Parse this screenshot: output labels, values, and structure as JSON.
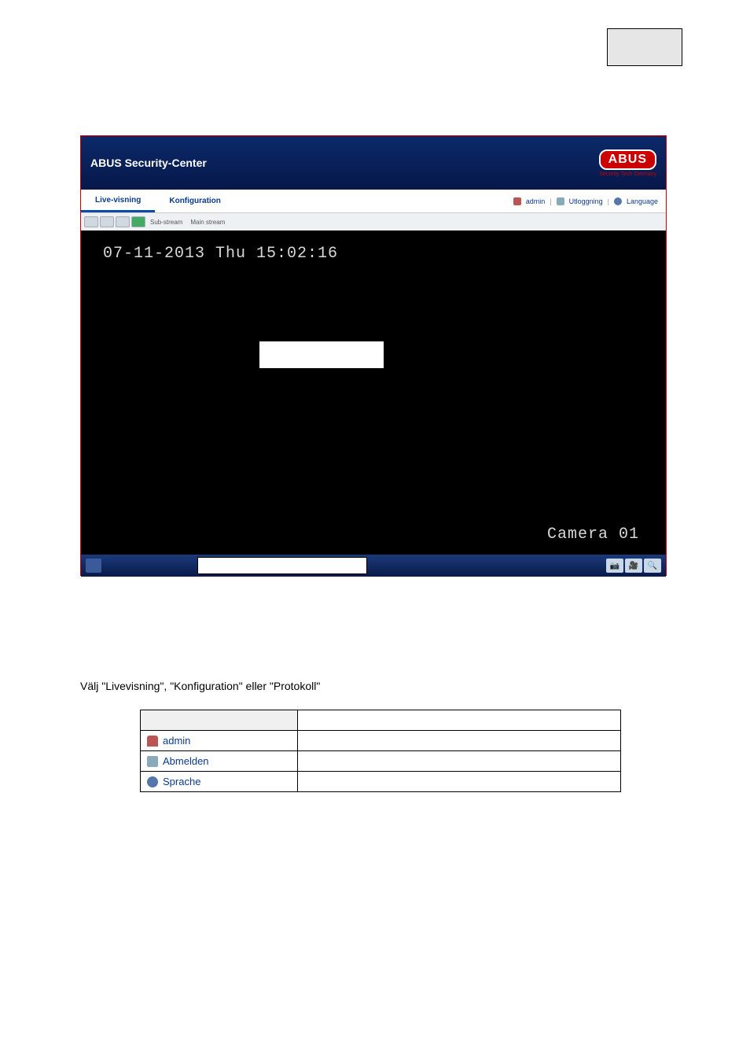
{
  "header": {
    "title_bold": "ABUS",
    "title_rest": "Security-Center",
    "logo_text": "ABUS",
    "logo_sub": "Security Tech Germany"
  },
  "tabs": {
    "live": "Live-visning",
    "config": "Konfiguration"
  },
  "topright": {
    "user": "admin",
    "logout": "Utloggning",
    "language": "Language"
  },
  "toolbar": {
    "sub": "Sub-stream",
    "main": "Main stream"
  },
  "video": {
    "timestamp": "07-11-2013 Thu 15:02:16",
    "camera": "Camera 01"
  },
  "caption": "Välj \"Livevisning\", \"Konfiguration\" eller \"Protokoll\"",
  "table": {
    "rows": [
      {
        "label": "admin",
        "icon": "user"
      },
      {
        "label": "Abmelden",
        "icon": "logout"
      },
      {
        "label": "Sprache",
        "icon": "globe"
      }
    ]
  }
}
